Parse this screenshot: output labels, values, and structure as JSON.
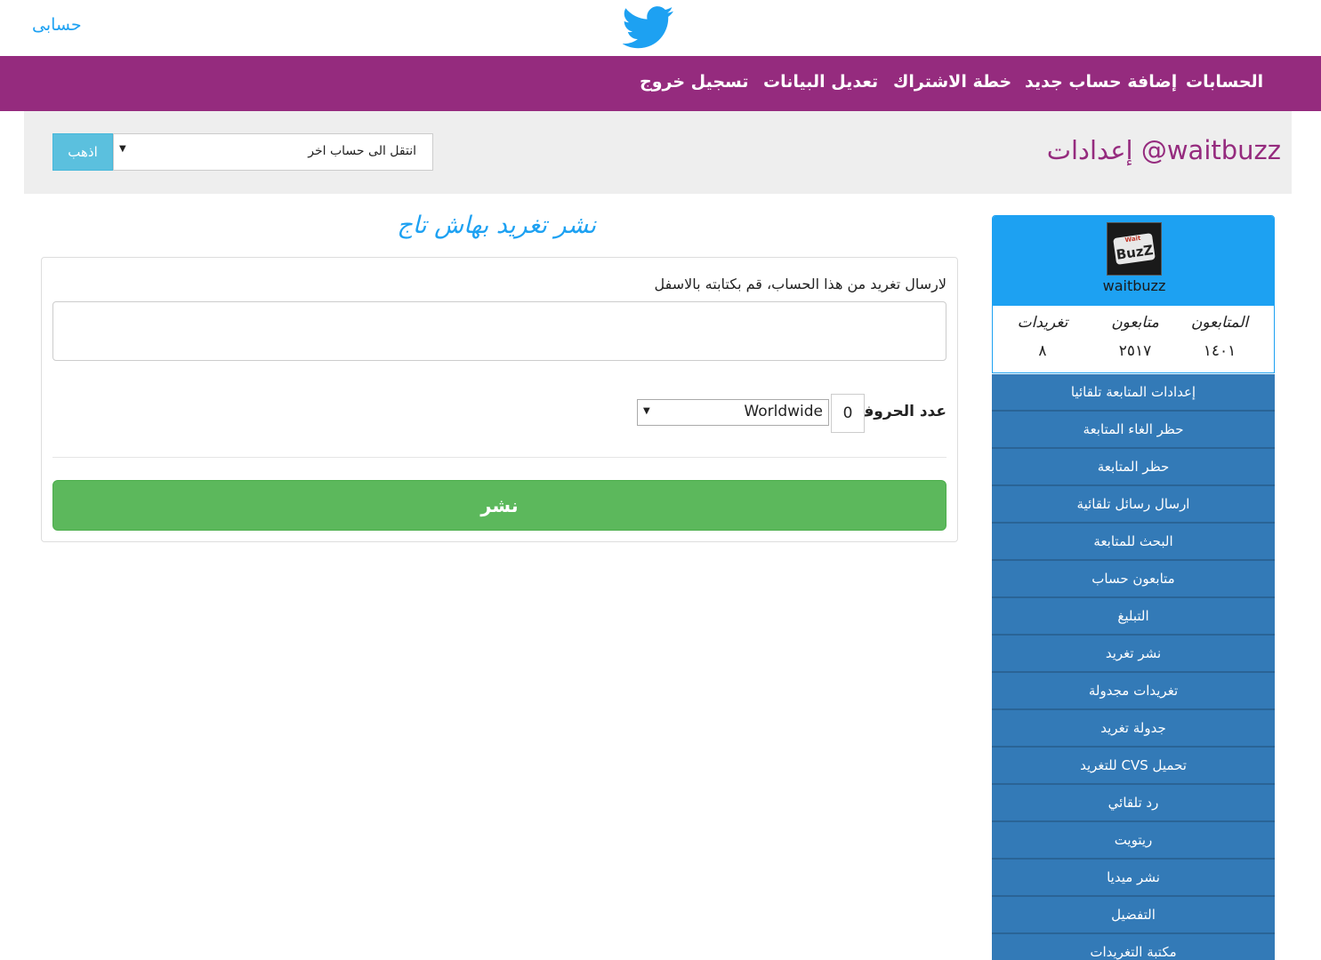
{
  "header": {
    "my_account": "حسابى",
    "logo_icon": "twitter-bird-icon",
    "brand_color": "#1da1f2"
  },
  "nav": {
    "accent_color": "#952b7e",
    "items": [
      {
        "label": "الحسابات"
      },
      {
        "label": "إضافة حساب جديد"
      },
      {
        "label": "خطة الاشتراك"
      },
      {
        "label": "تعديل البيانات"
      },
      {
        "label": "تسجيل خروج"
      }
    ]
  },
  "settings": {
    "title": "إعدادات @waitbuzz",
    "account_select_value": "انتقل الى حساب اخر",
    "go_label": "اذهب"
  },
  "compose": {
    "section_title": "نشر تغريد بهاش تاج",
    "instructions": "لارسال تغريد من هذا الحساب، قم بكتابته بالاسفل",
    "textarea_value": "",
    "char_label": "عدد الحروف",
    "char_count": "0",
    "location_value": "Worldwide",
    "publish_label": "نشر"
  },
  "profile": {
    "username": "waitbuzz",
    "avatar_text": "Wait BuzZ",
    "stats": [
      {
        "label": "المتابعون",
        "value": "١٤٠١"
      },
      {
        "label": "متابعون",
        "value": "٢٥١٧"
      },
      {
        "label": "تغريدات",
        "value": "٨"
      }
    ]
  },
  "sidebar": {
    "items": [
      {
        "label": "إعدادات المتابعة تلقائيا"
      },
      {
        "label": "حظر الغاء المتابعة"
      },
      {
        "label": "حظر المتابعة"
      },
      {
        "label": "ارسال رسائل تلقائية"
      },
      {
        "label": "البحث للمتابعة"
      },
      {
        "label": "متابعون حساب"
      },
      {
        "label": "التبليغ"
      },
      {
        "label": "نشر تغريد"
      },
      {
        "label": "تغريدات مجدولة"
      },
      {
        "label": "جدولة تغريد"
      },
      {
        "label": "تحميل CVS للتغريد"
      },
      {
        "label": "رد تلقائي"
      },
      {
        "label": "ريتويت"
      },
      {
        "label": "نشر ميديا"
      },
      {
        "label": "التفضيل"
      },
      {
        "label": "مكتبة التغريدات"
      }
    ]
  }
}
